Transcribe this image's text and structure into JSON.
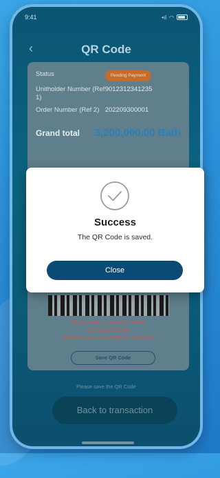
{
  "status_bar": {
    "time": "9:41",
    "signal": "•ıl",
    "wifi": "◠"
  },
  "header": {
    "back": "‹",
    "title": "QR Code"
  },
  "details": {
    "status_label": "Status",
    "status_value": "Pending Payment",
    "unitholder_label": "Unitholder Number (Ref 1)",
    "unitholder_value": "9012312341235",
    "order_label": "Order Number (Ref 2)",
    "order_value": "202209300001",
    "grand_total_label": "Grand total",
    "grand_total_value": "3,200,000.00 Bath"
  },
  "warning": {
    "line1": "Please make a payment within",
    "line2": "01/01/2023  23:59",
    "line3": "otherwise your order will be cancelled."
  },
  "save_qr_label": "Save QR Code",
  "hint": "Please save the QR Code",
  "back_to_transaction": "Back to transaction",
  "modal": {
    "title": "Success",
    "message": "The QR Code is saved.",
    "close_label": "Close",
    "icon": "check-circle-icon"
  },
  "colors": {
    "accent": "#0a4a74",
    "pending": "#c56c2c",
    "grand_total": "#2c7fb8",
    "warning": "#c9584f"
  }
}
